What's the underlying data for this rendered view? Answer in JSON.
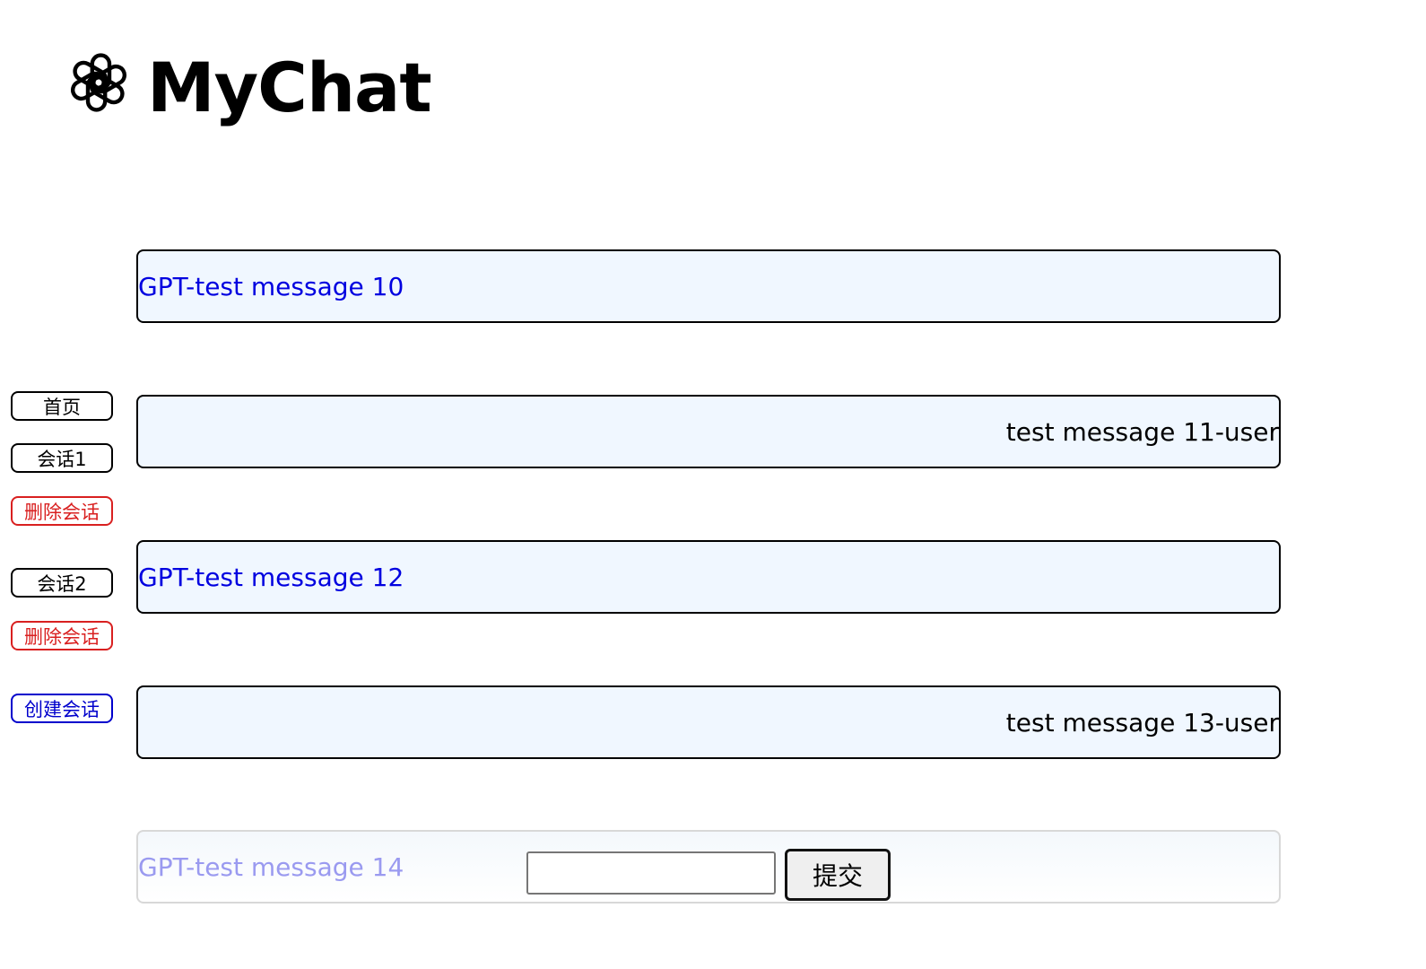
{
  "header": {
    "title": "MyChat",
    "logo_icon": "openai-logo-icon"
  },
  "sidebar": {
    "home_label": "首页",
    "sessions": [
      {
        "label": "会话1",
        "delete_label": "删除会话"
      },
      {
        "label": "会话2",
        "delete_label": "删除会话"
      }
    ],
    "create_label": "创建会话"
  },
  "messages": [
    {
      "role": "gpt",
      "text": "GPT-test message 10"
    },
    {
      "role": "user",
      "text": "test message 11-user"
    },
    {
      "role": "gpt",
      "text": "GPT-test message 12"
    },
    {
      "role": "user",
      "text": "test message 13-user"
    },
    {
      "role": "gpt",
      "text": "GPT-test message 14"
    }
  ],
  "composer": {
    "input_value": "",
    "submit_label": "提交"
  },
  "colors": {
    "gpt_text": "#0000e0",
    "user_text": "#000000",
    "delete": "#d92020",
    "create": "#0000cc",
    "bubble_bg": "#f0f7ff"
  }
}
